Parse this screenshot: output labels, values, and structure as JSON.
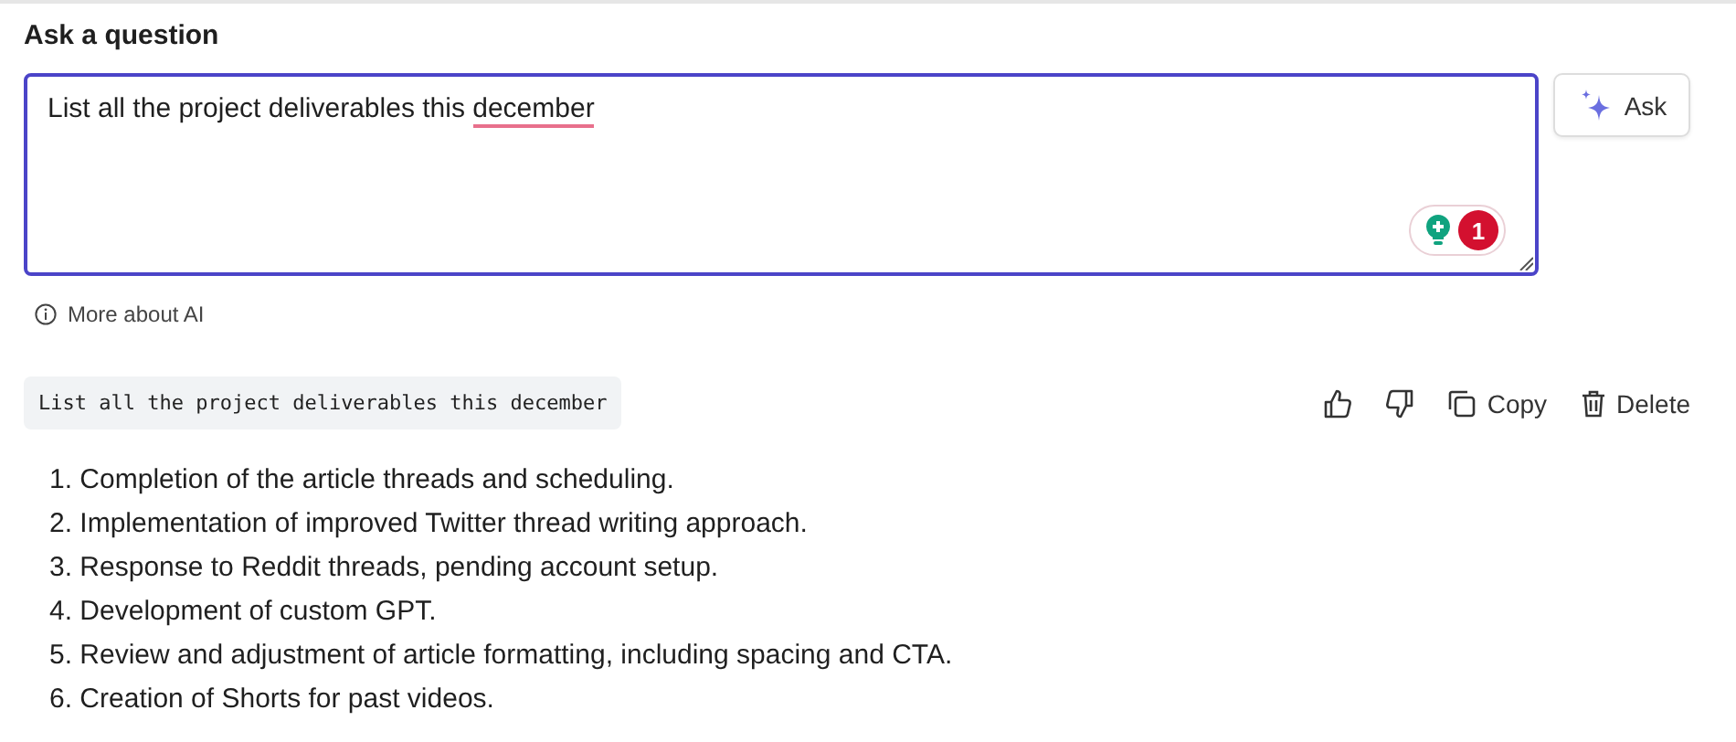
{
  "heading": "Ask a question",
  "question": {
    "parts": [
      {
        "text": "List all the project deliverables this ",
        "misspelled": false
      },
      {
        "text": "december",
        "misspelled": true
      }
    ],
    "focused": true,
    "checker_count": "1"
  },
  "ask_button": "Ask",
  "info_link": "More about AI",
  "asked_query": "List all the project deliverables this december",
  "actions": [
    {
      "kind": "like"
    },
    {
      "kind": "dislike"
    },
    {
      "kind": "copy",
      "label": "Copy"
    },
    {
      "kind": "delete",
      "label": "Delete"
    }
  ],
  "answer": [
    "1. Completion of the article threads and scheduling.",
    "2. Implementation of improved Twitter thread writing approach.",
    "3. Response to Reddit threads, pending account setup.",
    "4. Development of custom GPT.",
    "5. Review and adjustment of article formatting, including spacing and CTA.",
    "6. Creation of Shorts for past videos."
  ]
}
